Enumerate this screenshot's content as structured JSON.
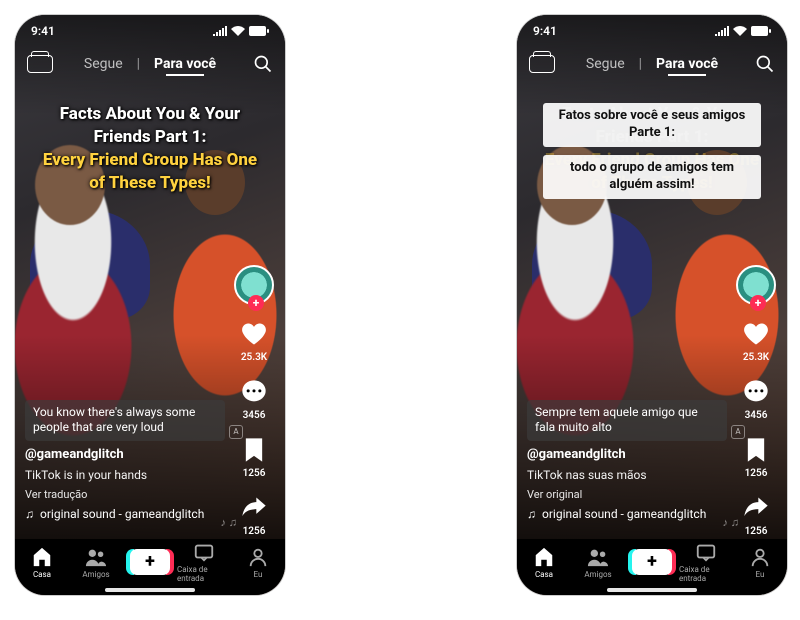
{
  "status": {
    "time": "9:41"
  },
  "topnav": {
    "follow": "Segue",
    "foryou": "Para você"
  },
  "overlayA": {
    "line1": "Facts About You & Your Friends Part 1:",
    "line2": "Every Friend Group Has One of These Types!"
  },
  "overlayB": {
    "cap1": "Fatos sobre você e seus amigos Parte 1:",
    "cap2": "todo o grupo de amigos tem alguém assim!"
  },
  "rail": {
    "likes": "25.3K",
    "comments": "3456",
    "saves": "1256",
    "shares": "1256"
  },
  "captionA": {
    "subtitle": "You know there's always some people that are very loud",
    "handle": "@gameandglitch",
    "desc": "TikTok is in your hands",
    "translate": "Ver tradução",
    "sound": "original sound - gameandglitch",
    "music_glyph": "♫"
  },
  "captionB": {
    "subtitle": "Sempre tem aquele amigo que fala muito alto",
    "handle": "@gameandglitch",
    "desc": "TikTok nas suas mãos",
    "translate": "Ver original",
    "sound": "original sound - gameandglitch",
    "music_glyph": "♫"
  },
  "bottomnav": {
    "home": "Casa",
    "friends": "Amigos",
    "inbox": "Caixa de entrada",
    "profile": "Eu"
  }
}
